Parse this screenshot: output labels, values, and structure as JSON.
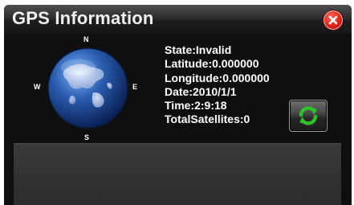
{
  "window": {
    "title": "GPS Information"
  },
  "compass": {
    "north": "N",
    "south": "S",
    "east": "E",
    "west": "W"
  },
  "info": {
    "state": "State:Invalid",
    "latitude": "Latitude:0.000000",
    "longitude": "Longitude:0.000000",
    "date": "Date:2010/1/1",
    "time": "Time:2:9:18",
    "satellites": "TotalSatellites:0"
  },
  "icons": {
    "close": "close-icon",
    "refresh": "refresh-icon",
    "globe": "globe-icon"
  },
  "colors": {
    "close_red": "#e01e12",
    "refresh_green": "#2fbf2a",
    "globe_blue": "#2a5db0"
  }
}
